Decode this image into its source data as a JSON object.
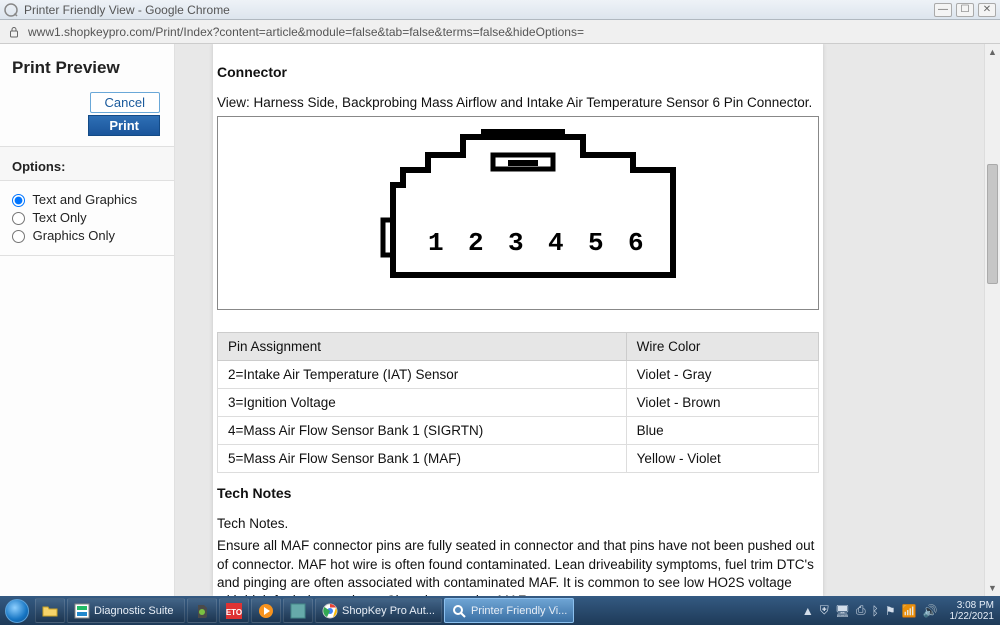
{
  "window": {
    "title": "Printer Friendly View - Google Chrome",
    "url": "www1.shopkeypro.com/Print/Index?content=article&module=false&tab=false&terms=false&hideOptions="
  },
  "sidebar": {
    "heading": "Print Preview",
    "cancel_label": "Cancel",
    "print_label": "Print",
    "options_label": "Options:",
    "radios": {
      "text_and_graphics": "Text and Graphics",
      "text_only": "Text Only",
      "graphics_only": "Graphics Only"
    }
  },
  "article": {
    "connector_heading": "Connector",
    "view_text": "View: Harness Side, Backprobing Mass Airflow and Intake Air Temperature Sensor 6 Pin Connector.",
    "diagram_pins": [
      "1",
      "2",
      "3",
      "4",
      "5",
      "6"
    ],
    "table": {
      "col_pin": "Pin Assignment",
      "col_color": "Wire Color",
      "rows": [
        {
          "pin": "2=Intake Air Temperature (IAT) Sensor",
          "color": "Violet - Gray"
        },
        {
          "pin": "3=Ignition Voltage",
          "color": "Violet - Brown"
        },
        {
          "pin": "4=Mass Air Flow Sensor Bank 1 (SIGRTN)",
          "color": "Blue"
        },
        {
          "pin": "5=Mass Air Flow Sensor Bank 1 (MAF)",
          "color": "Yellow - Violet"
        }
      ]
    },
    "tech_notes_heading": "Tech Notes",
    "tech_notes_lead": "Tech Notes.",
    "tech_notes_body": "Ensure all MAF connector pins are fully seated in connector and that pins have not been pushed out of connector. MAF hot wire is often found contaminated. Lean driveability symptoms, fuel trim DTC's and pinging are often associated with contaminated MAF. It is common to see low HO2S voltage with high fuel trim numbers. Clean by spraying MAF"
  },
  "taskbar": {
    "items": [
      {
        "label": "Diagnostic Suite"
      },
      {
        "label": "ShopKey Pro Aut..."
      },
      {
        "label": "Printer Friendly Vi..."
      }
    ],
    "time": "3:08 PM",
    "date": "1/22/2021"
  }
}
